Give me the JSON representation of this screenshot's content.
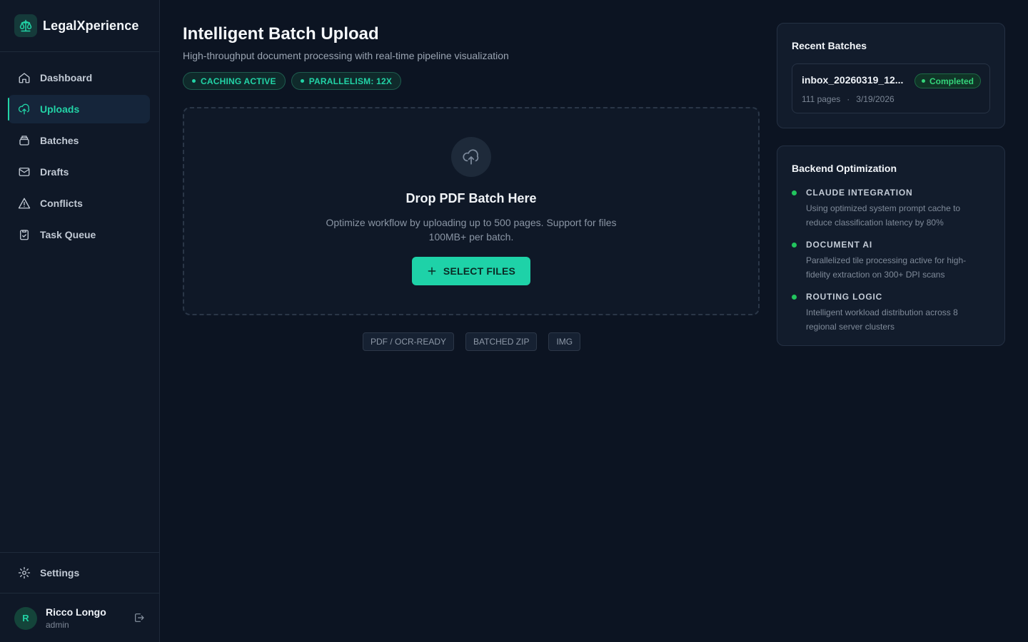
{
  "brand": {
    "name": "LegalXperience"
  },
  "nav": [
    {
      "label": "Dashboard",
      "icon": "home-icon",
      "active": false
    },
    {
      "label": "Uploads",
      "icon": "upload-cloud-icon",
      "active": true
    },
    {
      "label": "Batches",
      "icon": "layers-icon",
      "active": false
    },
    {
      "label": "Drafts",
      "icon": "mail-icon",
      "active": false
    },
    {
      "label": "Conflicts",
      "icon": "warning-icon",
      "active": false
    },
    {
      "label": "Task Queue",
      "icon": "clipboard-check-icon",
      "active": false
    }
  ],
  "settings": {
    "label": "Settings"
  },
  "user": {
    "initial": "R",
    "name": "Ricco Longo",
    "role": "admin"
  },
  "page": {
    "title": "Intelligent Batch Upload",
    "subtitle": "High-throughput document processing with real-time pipeline visualization",
    "pills": [
      "CACHING ACTIVE",
      "PARALLELISM: 12X"
    ]
  },
  "dropzone": {
    "title": "Drop PDF Batch Here",
    "description": "Optimize workflow by uploading up to 500 pages. Support for files 100MB+ per batch.",
    "button_label": "SELECT FILES",
    "formats": [
      "PDF / OCR-READY",
      "BATCHED ZIP",
      "IMG"
    ]
  },
  "recent": {
    "title": "Recent Batches",
    "batch": {
      "name": "inbox_20260319_12...",
      "status": "Completed",
      "pages": "111 pages",
      "sep": "·",
      "date": "3/19/2026"
    }
  },
  "backend": {
    "title": "Backend Optimization",
    "items": [
      {
        "head": "CLAUDE INTEGRATION",
        "desc": "Using optimized system prompt cache to reduce classification latency by 80%"
      },
      {
        "head": "DOCUMENT AI",
        "desc": "Parallelized tile processing active for high-fidelity extraction on 300+ DPI scans"
      },
      {
        "head": "ROUTING LOGIC",
        "desc": "Intelligent workload distribution across 8 regional server clusters"
      }
    ]
  },
  "colors": {
    "accent": "#22d3a6",
    "success": "#22c55e",
    "background": "#0c1422"
  }
}
